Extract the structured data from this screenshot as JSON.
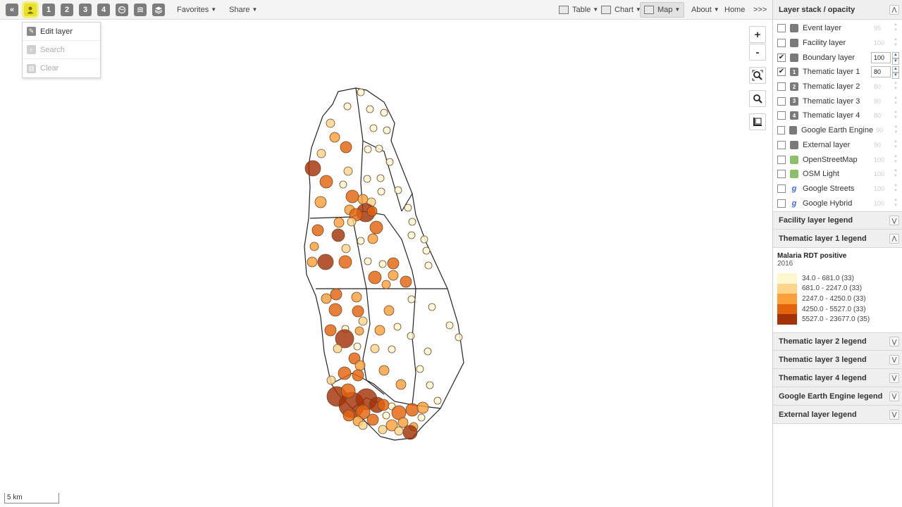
{
  "toolbar": {
    "layer_buttons": [
      {
        "name": "back-icon",
        "glyph": "«"
      },
      {
        "name": "facility-layer-icon",
        "glyph": ""
      },
      {
        "name": "thematic-layer-1-icon",
        "glyph": "1"
      },
      {
        "name": "thematic-layer-2-icon",
        "glyph": "2"
      },
      {
        "name": "thematic-layer-3-icon",
        "glyph": "3"
      },
      {
        "name": "thematic-layer-4-icon",
        "glyph": "4"
      },
      {
        "name": "boundary-layer-icon",
        "glyph": ""
      },
      {
        "name": "earth-engine-layer-icon",
        "glyph": ""
      },
      {
        "name": "external-layer-icon",
        "glyph": ""
      }
    ],
    "favorites": "Favorites",
    "share": "Share",
    "table": "Table",
    "chart": "Chart",
    "map": "Map",
    "about": "About",
    "home": "Home",
    "more": ">>>"
  },
  "dropdown": {
    "items": [
      {
        "label": "Edit layer",
        "enabled": true
      },
      {
        "label": "Search",
        "enabled": false
      },
      {
        "label": "Clear",
        "enabled": false
      }
    ]
  },
  "map": {
    "zoom_in": "+",
    "zoom_out": "-",
    "scale_label": "5 km"
  },
  "panel": {
    "title": "Layer stack / opacity",
    "layers": [
      {
        "name": "Event layer",
        "checked": false,
        "opacity": "95",
        "icon": "event-icon"
      },
      {
        "name": "Facility layer",
        "checked": false,
        "opacity": "100",
        "icon": "facility-icon"
      },
      {
        "name": "Boundary layer",
        "checked": true,
        "opacity": "100",
        "icon": "boundary-icon"
      },
      {
        "name": "Thematic layer 1",
        "checked": true,
        "opacity": "80",
        "icon": "thematic-1-icon",
        "glyph": "1"
      },
      {
        "name": "Thematic layer 2",
        "checked": false,
        "opacity": "80",
        "icon": "thematic-2-icon",
        "glyph": "2"
      },
      {
        "name": "Thematic layer 3",
        "checked": false,
        "opacity": "80",
        "icon": "thematic-3-icon",
        "glyph": "3"
      },
      {
        "name": "Thematic layer 4",
        "checked": false,
        "opacity": "80",
        "icon": "thematic-4-icon",
        "glyph": "4"
      },
      {
        "name": "Google Earth Engine",
        "checked": false,
        "opacity": "90",
        "icon": "earth-engine-icon"
      },
      {
        "name": "External layer",
        "checked": false,
        "opacity": "90",
        "icon": "external-icon"
      },
      {
        "name": "OpenStreetMap",
        "checked": false,
        "opacity": "100",
        "icon": "osm-icon"
      },
      {
        "name": "OSM Light",
        "checked": false,
        "opacity": "100",
        "icon": "osm-light-icon"
      },
      {
        "name": "Google Streets",
        "checked": false,
        "opacity": "100",
        "icon": "google-streets-icon"
      },
      {
        "name": "Google Hybrid",
        "checked": false,
        "opacity": "100",
        "icon": "google-hybrid-icon"
      }
    ],
    "legends": {
      "facility": "Facility layer legend",
      "thematic1": "Thematic layer 1 legend",
      "thematic2": "Thematic layer 2 legend",
      "thematic3": "Thematic layer 3 legend",
      "thematic4": "Thematic layer 4 legend",
      "gee": "Google Earth Engine legend",
      "external": "External layer legend"
    },
    "thematic_legend": {
      "title": "Malaria RDT positive",
      "period": "2016",
      "classes": [
        {
          "label": "34.0 - 681.0 (33)",
          "color": "#fff7cf"
        },
        {
          "label": "681.0 - 2247.0 (33)",
          "color": "#fed48a"
        },
        {
          "label": "2247.0 - 4250.0 (33)",
          "color": "#fd9f3a"
        },
        {
          "label": "4250.0 - 5527.0 (33)",
          "color": "#e4640e"
        },
        {
          "label": "5527.0 - 23677.0 (35)",
          "color": "#a33208"
        }
      ]
    }
  }
}
